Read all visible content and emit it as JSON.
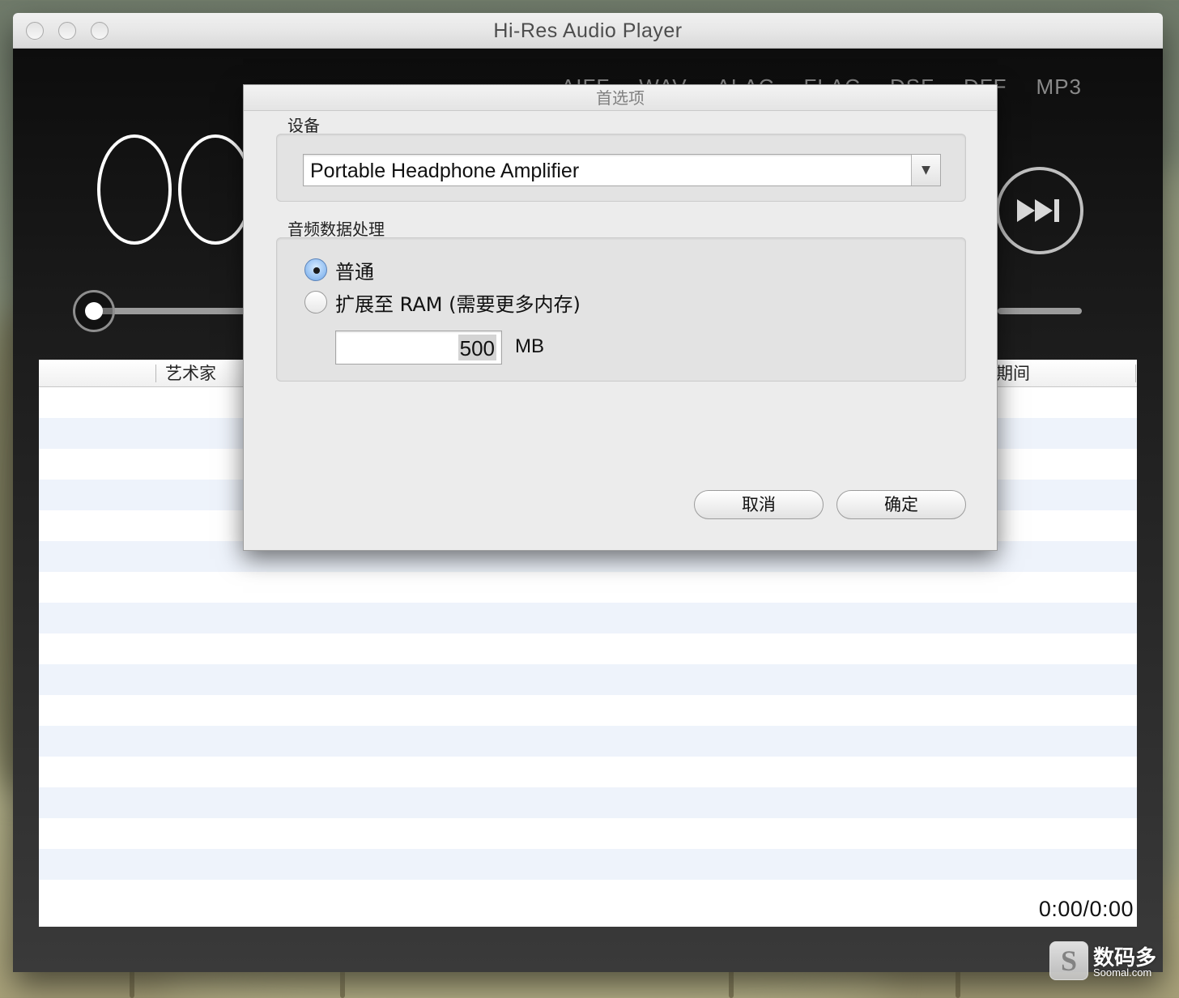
{
  "window": {
    "title": "Hi-Res Audio Player"
  },
  "player": {
    "formats": [
      "AIFF",
      "WAV",
      "ALAC",
      "FLAC",
      "DSF",
      "DFF",
      "MP3"
    ],
    "time_display": "00",
    "elapsed": "0:00/0:00"
  },
  "playlist": {
    "columns": [
      "艺术家",
      "期间"
    ]
  },
  "preferences": {
    "title": "首选项",
    "device_group_label": "设备",
    "device_value": "Portable Headphone Amplifier",
    "audio_group_label": "音频数据处理",
    "options": [
      {
        "label": "普通",
        "selected": true
      },
      {
        "label": "扩展至 RAM (需要更多内存)",
        "selected": false
      }
    ],
    "ram_value": "500",
    "ram_unit": "MB",
    "cancel_label": "取消",
    "ok_label": "确定"
  },
  "watermark": {
    "logo_letter": "S",
    "name": "数码多",
    "site": "Soomal.com"
  },
  "colors": {
    "selected_radio": "#8dbbf0",
    "row_alt": "#eef3fb"
  }
}
